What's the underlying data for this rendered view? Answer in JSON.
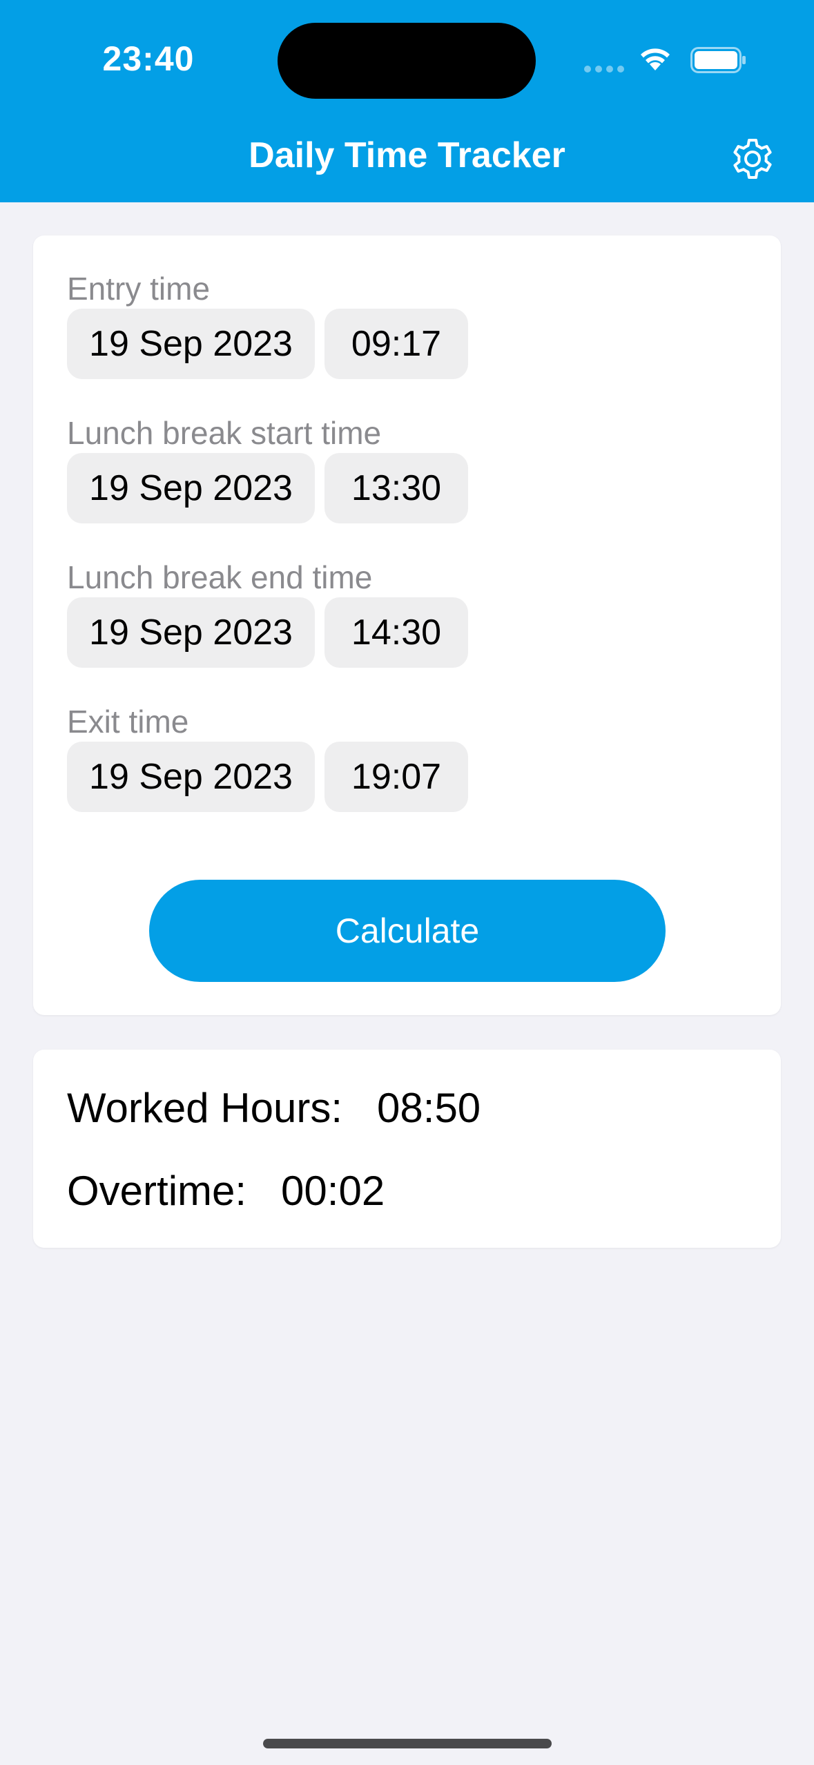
{
  "status_bar": {
    "time": "23:40"
  },
  "header": {
    "title": "Daily Time Tracker",
    "settings_icon": "gear-icon"
  },
  "form": {
    "fields": [
      {
        "label": "Entry time",
        "date": "19 Sep 2023",
        "time": "09:17"
      },
      {
        "label": "Lunch break start time",
        "date": "19 Sep 2023",
        "time": "13:30"
      },
      {
        "label": "Lunch break end time",
        "date": "19 Sep 2023",
        "time": "14:30"
      },
      {
        "label": "Exit time",
        "date": "19 Sep 2023",
        "time": "19:07"
      }
    ],
    "calculate_label": "Calculate"
  },
  "results": {
    "worked_hours_label": "Worked Hours:",
    "worked_hours_value": "08:50",
    "overtime_label": "Overtime:",
    "overtime_value": "00:02"
  },
  "colors": {
    "accent": "#039fe6",
    "background": "#f2f2f7",
    "card": "#ffffff",
    "pill": "#eeeeef",
    "label": "#8a8a8e"
  }
}
